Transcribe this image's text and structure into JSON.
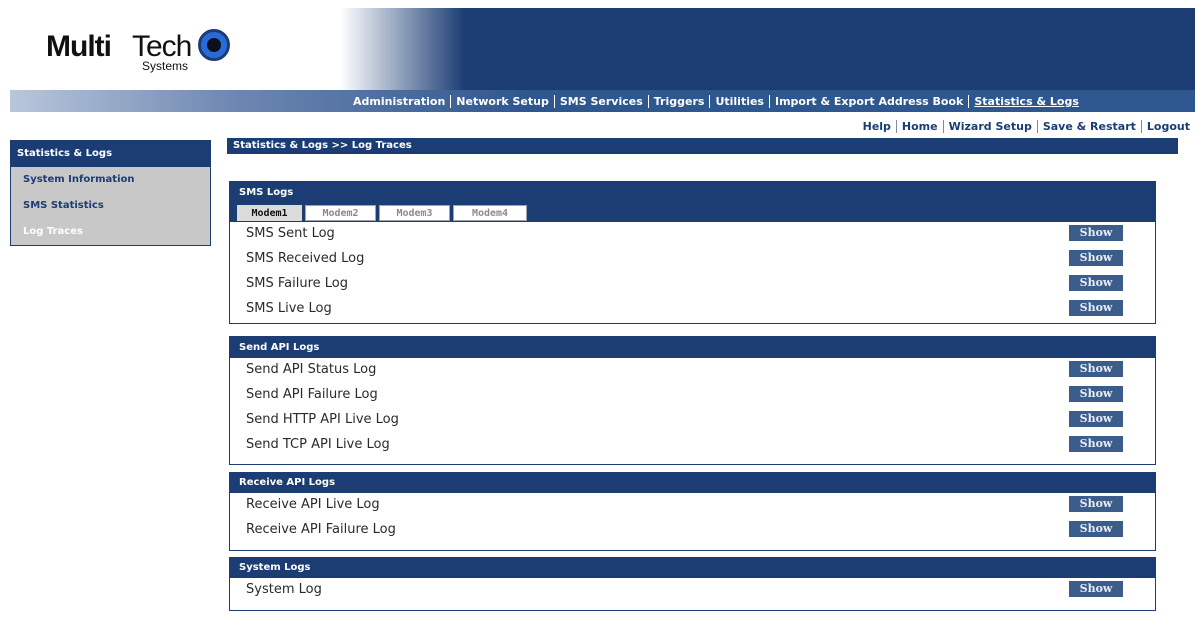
{
  "logo": {
    "multi": "Multi",
    "tech": "Tech",
    "systems": "Systems"
  },
  "topnav": [
    {
      "label": "Administration"
    },
    {
      "label": "Network Setup"
    },
    {
      "label": "SMS Services"
    },
    {
      "label": "Triggers"
    },
    {
      "label": "Utilities"
    },
    {
      "label": "Import & Export Address Book"
    },
    {
      "label": "Statistics & Logs"
    }
  ],
  "utility": [
    {
      "label": "Help"
    },
    {
      "label": "Home"
    },
    {
      "label": "Wizard Setup"
    },
    {
      "label": "Save & Restart"
    },
    {
      "label": "Logout"
    }
  ],
  "sidebar": {
    "title": "Statistics & Logs",
    "items": [
      {
        "label": "System Information"
      },
      {
        "label": "SMS Statistics"
      },
      {
        "label": "Log Traces"
      }
    ]
  },
  "breadcrumb": "Statistics & Logs >> Log Traces",
  "sms_logs": {
    "title": "SMS Logs",
    "tabs": [
      {
        "label": "Modem1"
      },
      {
        "label": "Modem2"
      },
      {
        "label": "Modem3"
      },
      {
        "label": "Modem4"
      }
    ],
    "rows": [
      {
        "label": "SMS Sent Log",
        "action": "Show"
      },
      {
        "label": "SMS Received Log",
        "action": "Show"
      },
      {
        "label": "SMS Failure Log",
        "action": "Show"
      },
      {
        "label": "SMS Live Log",
        "action": "Show"
      }
    ]
  },
  "send_api_logs": {
    "title": "Send API Logs",
    "rows": [
      {
        "label": "Send API Status Log",
        "action": "Show"
      },
      {
        "label": "Send API Failure Log",
        "action": "Show"
      },
      {
        "label": "Send HTTP API Live Log",
        "action": "Show"
      },
      {
        "label": "Send TCP API Live Log",
        "action": "Show"
      }
    ]
  },
  "receive_api_logs": {
    "title": "Receive API Logs",
    "rows": [
      {
        "label": "Receive API Live Log",
        "action": "Show"
      },
      {
        "label": "Receive API Failure Log",
        "action": "Show"
      }
    ]
  },
  "system_logs": {
    "title": "System Logs",
    "rows": [
      {
        "label": "System Log",
        "action": "Show"
      }
    ]
  },
  "colors": {
    "navy": "#1b3d74",
    "nav_bar": "#2e568f",
    "sidebar_bg": "#c8c8c8",
    "button": "#3c5c8c"
  }
}
